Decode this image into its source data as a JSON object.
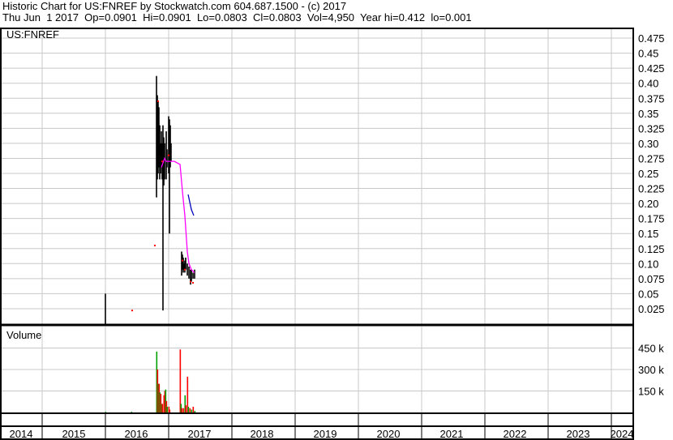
{
  "header": {
    "title": "Historic Chart for US:FNREF by Stockwatch.com 604.687.1500 - (c) 2017",
    "quote": "Thu Jun  1 2017  Op=0.0901  Hi=0.0901  Lo=0.0803  Cl=0.0803  Vol=4,950  Year hi=0.412  lo=0.001"
  },
  "chart_data": {
    "type": "bar",
    "symbol_label": "US:FNREF",
    "volume_label": "Volume",
    "price_ticks": [
      "0.025",
      "0.05",
      "0.075",
      "0.10",
      "0.125",
      "0.15",
      "0.175",
      "0.20",
      "0.225",
      "0.25",
      "0.275",
      "0.30",
      "0.325",
      "0.35",
      "0.375",
      "0.40",
      "0.425",
      "0.45",
      "0.475"
    ],
    "price_ylim": [
      0,
      0.48
    ],
    "volume_ticks": [
      "150 k",
      "300 k",
      "450 k"
    ],
    "volume_ylim": [
      0,
      600000
    ],
    "x_years": [
      "2014",
      "2015",
      "2016",
      "2017",
      "2018",
      "2019",
      "2020",
      "2021",
      "2022",
      "2023",
      "2024"
    ],
    "xlim": [
      2014.33,
      2024.35
    ],
    "price_bars": [
      [
        2016.0,
        0.05,
        0.0
      ],
      [
        2016.808,
        0.412,
        0.21
      ],
      [
        2016.821,
        0.38,
        0.24
      ],
      [
        2016.833,
        0.37,
        0.25
      ],
      [
        2016.846,
        0.36,
        0.26
      ],
      [
        2016.859,
        0.33,
        0.24
      ],
      [
        2016.872,
        0.3,
        0.25
      ],
      [
        2016.885,
        0.32,
        0.26
      ],
      [
        2016.897,
        0.3,
        0.24
      ],
      [
        2016.91,
        0.33,
        0.022
      ],
      [
        2016.923,
        0.31,
        0.23
      ],
      [
        2016.936,
        0.3,
        0.24
      ],
      [
        2016.962,
        0.32,
        0.24
      ],
      [
        2016.974,
        0.29,
        0.26
      ],
      [
        2017.0,
        0.345,
        0.25
      ],
      [
        2017.013,
        0.34,
        0.15
      ],
      [
        2017.026,
        0.33,
        0.26
      ],
      [
        2017.038,
        0.3,
        0.27
      ],
      [
        2017.205,
        0.12,
        0.08
      ],
      [
        2017.218,
        0.115,
        0.09
      ],
      [
        2017.231,
        0.11,
        0.085
      ],
      [
        2017.244,
        0.1,
        0.09
      ],
      [
        2017.256,
        0.105,
        0.085
      ],
      [
        2017.269,
        0.11,
        0.09
      ],
      [
        2017.295,
        0.1,
        0.08
      ],
      [
        2017.321,
        0.095,
        0.075
      ],
      [
        2017.346,
        0.09,
        0.065
      ],
      [
        2017.359,
        0.09,
        0.07
      ],
      [
        2017.385,
        0.085,
        0.075
      ],
      [
        2017.41,
        0.09,
        0.075
      ]
    ],
    "red_points": [
      [
        2016.782,
        0.13
      ],
      [
        2016.423,
        0.022
      ],
      [
        2016.833,
        0.37
      ],
      [
        2016.897,
        0.27
      ],
      [
        2017.0,
        0.28
      ],
      [
        2017.218,
        0.105
      ],
      [
        2017.256,
        0.09
      ],
      [
        2017.346,
        0.07
      ],
      [
        2017.385,
        0.068
      ]
    ],
    "moving_average": [
      [
        2016.885,
        0.26
      ],
      [
        2016.936,
        0.275
      ],
      [
        2016.962,
        0.27
      ],
      [
        2016.987,
        0.27
      ],
      [
        2017.026,
        0.27
      ],
      [
        2017.09,
        0.27
      ],
      [
        2017.18,
        0.265
      ],
      [
        2017.218,
        0.22
      ],
      [
        2017.256,
        0.18
      ],
      [
        2017.295,
        0.12
      ],
      [
        2017.321,
        0.1
      ],
      [
        2017.359,
        0.09
      ],
      [
        2017.41,
        0.085
      ]
    ],
    "trend_line": [
      [
        2017.308,
        0.215
      ],
      [
        2017.359,
        0.19
      ],
      [
        2017.397,
        0.18
      ]
    ],
    "volume_bars": [
      [
        2016.0,
        5000,
        "g"
      ],
      [
        2016.41,
        5000,
        "g"
      ],
      [
        2016.808,
        425000,
        "g"
      ],
      [
        2016.821,
        300000,
        "r"
      ],
      [
        2016.833,
        200000,
        "g"
      ],
      [
        2016.846,
        200000,
        "r"
      ],
      [
        2016.859,
        140000,
        "g"
      ],
      [
        2016.872,
        130000,
        "r"
      ],
      [
        2016.885,
        60000,
        "g"
      ],
      [
        2016.897,
        60000,
        "r"
      ],
      [
        2016.923,
        120000,
        "r"
      ],
      [
        2016.936,
        150000,
        "r"
      ],
      [
        2016.949,
        160000,
        "g"
      ],
      [
        2016.962,
        80000,
        "r"
      ],
      [
        2016.974,
        40000,
        "g"
      ],
      [
        2017.0,
        40000,
        "r"
      ],
      [
        2017.013,
        20000,
        "r"
      ],
      [
        2017.18,
        440000,
        "r"
      ],
      [
        2017.192,
        60000,
        "g"
      ],
      [
        2017.205,
        30000,
        "r"
      ],
      [
        2017.231,
        30000,
        "r"
      ],
      [
        2017.256,
        120000,
        "g"
      ],
      [
        2017.269,
        50000,
        "r"
      ],
      [
        2017.295,
        250000,
        "r"
      ],
      [
        2017.308,
        40000,
        "g"
      ],
      [
        2017.333,
        30000,
        "r"
      ],
      [
        2017.359,
        20000,
        "g"
      ],
      [
        2017.385,
        40000,
        "r"
      ],
      [
        2017.41,
        10000,
        "g"
      ]
    ],
    "colors": {
      "up": "#00a000",
      "down": "#ff0000",
      "ma": "#ff00ff",
      "trend": "#0000c0",
      "grid": "#c8c8c8"
    }
  }
}
